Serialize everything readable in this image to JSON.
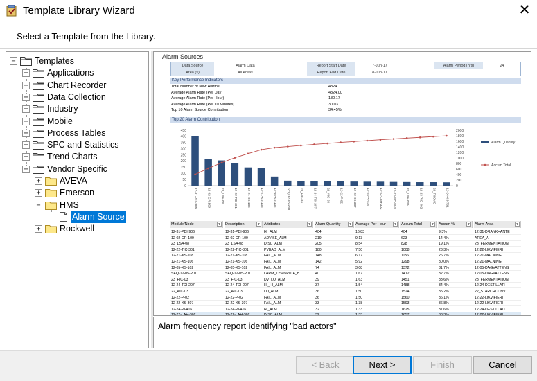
{
  "window": {
    "title": "Template Library Wizard",
    "close_glyph": "✕"
  },
  "subtitle": "Select a Template from the Library.",
  "tree": {
    "root": "Templates",
    "items": [
      {
        "label": "Applications"
      },
      {
        "label": "Chart Recorder"
      },
      {
        "label": "Data Collection"
      },
      {
        "label": "Industry"
      },
      {
        "label": "Mobile"
      },
      {
        "label": "Process Tables"
      },
      {
        "label": "SPC and Statistics"
      },
      {
        "label": "Trend Charts"
      },
      {
        "label": "Vendor Specific"
      },
      {
        "label": "AVEVA"
      },
      {
        "label": "Emerson"
      },
      {
        "label": "HMS"
      },
      {
        "label": "Alarm Source"
      },
      {
        "label": "Rockwell"
      }
    ]
  },
  "preview": {
    "title": "Alarm Sources",
    "header": {
      "data_source_label": "Data Source",
      "data_source": "Alarm Data",
      "area_label": "Area (s)",
      "area": "All Areas",
      "start_label": "Report Start Date",
      "start": "7-Jun-17",
      "end_label": "Report End Date",
      "end": "8-Jun-17",
      "period_label": "Alarm Period (hrs)",
      "period": "24"
    },
    "kpi_title": "Key Performance Indicators",
    "kpis": [
      {
        "label": "Total Number of New Alarms",
        "value": "4324"
      },
      {
        "label": "Average Alarm Rate (Per Day)",
        "value": "4324.00"
      },
      {
        "label": "Average Alarm Rate (Per Hour)",
        "value": "180.17"
      },
      {
        "label": "Average Alarm Rate (Per 10 Minutes)",
        "value": "30.03"
      },
      {
        "label": "Top 10 Alarm Source Contribution",
        "value": "34.45%"
      }
    ],
    "chart_title": "Top 20 Alarm Contribution",
    "table": {
      "headers": [
        "Module/Node",
        "Description",
        "Attributes",
        "Alarm Quantity",
        "Average Per Hour",
        "Accum Total",
        "Accum %",
        "Alarm Area"
      ],
      "rows": [
        [
          "12-31-PDI-906",
          "12-31-PDI-906",
          "HI_ALM",
          "404",
          "16.83",
          "404",
          "9.3%",
          "12-31-DRANKHANTE"
        ],
        [
          "12-02-CR-109",
          "12-02-CR-109",
          "ADVISE_ALM",
          "219",
          "9.13",
          "623",
          "14.4%",
          "AREA_A"
        ],
        [
          "23_LSA-08",
          "23_LSA-08",
          "DISC_ALM",
          "205",
          "8.54",
          "828",
          "19.1%",
          "23_FERMENTATION"
        ],
        [
          "12-22-TIC-301",
          "12-22-TIC-301",
          "PVBAD_ALM",
          "180",
          "7.50",
          "1008",
          "23.3%",
          "12-22-LIKVIFIERI"
        ],
        [
          "12-21-XS-108",
          "12-21-XS-108",
          "FAIL_ALM",
          "148",
          "6.17",
          "1156",
          "26.7%",
          "12-21-MALNING"
        ],
        [
          "12-21-XS-106",
          "12-21-XS-106",
          "FAIL_ALM",
          "142",
          "5.92",
          "1298",
          "30.0%",
          "12-21-MALNING"
        ],
        [
          "12-05-XS-102",
          "12-05-XS-102",
          "FAIL_ALM",
          "74",
          "3.08",
          "1372",
          "31.7%",
          "12-05-DAGVATTENS"
        ],
        [
          "SEQ-12-05-P01",
          "SEQ-12-05-P01",
          "LARM_12S05P01A_B",
          "40",
          "1.67",
          "1412",
          "32.7%",
          "12-05-DAGVATTENS"
        ],
        [
          "23_FIC-03",
          "23_FIC-03",
          "DV_LO_ALM",
          "39",
          "1.63",
          "1451",
          "33.6%",
          "23_FERMENTATION"
        ],
        [
          "12-24-TDI-207",
          "12-24-TDI-207",
          "HI_HI_ALM",
          "37",
          "1.54",
          "1488",
          "34.4%",
          "12-24-DESTILLATI"
        ],
        [
          "22_AIC-03",
          "22_AIC-03",
          "LO_ALM",
          "36",
          "1.50",
          "1524",
          "35.2%",
          "22_STARCHCONV"
        ],
        [
          "12-22-P-02",
          "12-22-P-02",
          "FAIL_ALM",
          "36",
          "1.50",
          "1560",
          "36.1%",
          "12-22-LIKVIFIERI"
        ],
        [
          "12-22-XS-307",
          "12-22-XS-307",
          "FAIL_ALM",
          "33",
          "1.38",
          "1593",
          "36.8%",
          "12-22-LIKVIFIERI"
        ],
        [
          "12-24-PI-416",
          "12-24-PI-416",
          "HI_ALM",
          "32",
          "1.33",
          "1625",
          "37.6%",
          "12-24-DESTILLATI"
        ],
        [
          "12-22-LAH-302",
          "12-22-LAH-302",
          "DISC_ALM",
          "32",
          "1.33",
          "1657",
          "38.3%",
          "12-22-LIKVIFIERI"
        ]
      ]
    }
  },
  "chart_data": {
    "type": "bar",
    "title": "Top 20 Alarm Contribution",
    "categories": [
      "12-31-PDI-906",
      "12-02-CR-109",
      "23_LSA-08",
      "12-22-TIC-301",
      "12-21-XS-108",
      "12-21-XS-106",
      "12-05-XS-102",
      "SEQ-12-05-P01",
      "23_FIC-03",
      "12-24-TDI-207",
      "22_AIC-03",
      "12-22-P-02",
      "12-22-XS-307",
      "12-24-PI-416",
      "12-22-LAH-302",
      "12-23-FIC-804",
      "32_LSA-03A",
      "12-23-PIC-402",
      "23_FI09MG",
      "12-24-XS-701"
    ],
    "series": [
      {
        "name": "Alarm Quantity",
        "kind": "bar",
        "axis": "left",
        "color": "#2e4f7c",
        "values": [
          404,
          219,
          205,
          180,
          148,
          142,
          74,
          40,
          39,
          37,
          36,
          36,
          33,
          32,
          32,
          30,
          29,
          28,
          28,
          27
        ]
      },
      {
        "name": "Accum Total",
        "kind": "line",
        "axis": "right",
        "color": "#c0504d",
        "values": [
          404,
          623,
          828,
          1008,
          1156,
          1298,
          1372,
          1412,
          1451,
          1488,
          1524,
          1560,
          1593,
          1625,
          1657,
          1687,
          1716,
          1744,
          1772,
          1799
        ]
      }
    ],
    "ylim_left": [
      0,
      450
    ],
    "yticks_left": [
      "0",
      "50",
      "100",
      "150",
      "200",
      "250",
      "300",
      "350",
      "400",
      "450"
    ],
    "ylim_right": [
      0,
      2000
    ],
    "yticks_right": [
      "0",
      "200",
      "400",
      "600",
      "800",
      "1000",
      "1200",
      "1400",
      "1600",
      "1800",
      "2000"
    ],
    "legend_position": "right"
  },
  "description": "Alarm frequency report identifying \"bad actors\"",
  "buttons": {
    "back": "< Back",
    "next": "Next >",
    "finish": "Finish",
    "cancel": "Cancel"
  }
}
